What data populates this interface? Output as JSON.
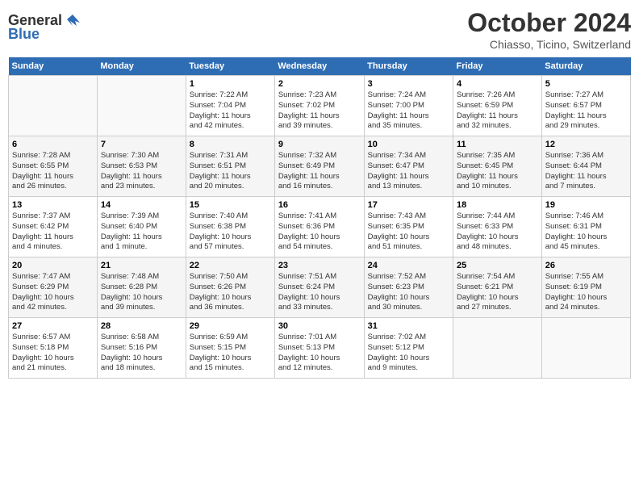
{
  "logo": {
    "general": "General",
    "blue": "Blue"
  },
  "title": "October 2024",
  "subtitle": "Chiasso, Ticino, Switzerland",
  "days_header": [
    "Sunday",
    "Monday",
    "Tuesday",
    "Wednesday",
    "Thursday",
    "Friday",
    "Saturday"
  ],
  "weeks": [
    [
      {
        "day": "",
        "info": ""
      },
      {
        "day": "",
        "info": ""
      },
      {
        "day": "1",
        "info": "Sunrise: 7:22 AM\nSunset: 7:04 PM\nDaylight: 11 hours\nand 42 minutes."
      },
      {
        "day": "2",
        "info": "Sunrise: 7:23 AM\nSunset: 7:02 PM\nDaylight: 11 hours\nand 39 minutes."
      },
      {
        "day": "3",
        "info": "Sunrise: 7:24 AM\nSunset: 7:00 PM\nDaylight: 11 hours\nand 35 minutes."
      },
      {
        "day": "4",
        "info": "Sunrise: 7:26 AM\nSunset: 6:59 PM\nDaylight: 11 hours\nand 32 minutes."
      },
      {
        "day": "5",
        "info": "Sunrise: 7:27 AM\nSunset: 6:57 PM\nDaylight: 11 hours\nand 29 minutes."
      }
    ],
    [
      {
        "day": "6",
        "info": "Sunrise: 7:28 AM\nSunset: 6:55 PM\nDaylight: 11 hours\nand 26 minutes."
      },
      {
        "day": "7",
        "info": "Sunrise: 7:30 AM\nSunset: 6:53 PM\nDaylight: 11 hours\nand 23 minutes."
      },
      {
        "day": "8",
        "info": "Sunrise: 7:31 AM\nSunset: 6:51 PM\nDaylight: 11 hours\nand 20 minutes."
      },
      {
        "day": "9",
        "info": "Sunrise: 7:32 AM\nSunset: 6:49 PM\nDaylight: 11 hours\nand 16 minutes."
      },
      {
        "day": "10",
        "info": "Sunrise: 7:34 AM\nSunset: 6:47 PM\nDaylight: 11 hours\nand 13 minutes."
      },
      {
        "day": "11",
        "info": "Sunrise: 7:35 AM\nSunset: 6:45 PM\nDaylight: 11 hours\nand 10 minutes."
      },
      {
        "day": "12",
        "info": "Sunrise: 7:36 AM\nSunset: 6:44 PM\nDaylight: 11 hours\nand 7 minutes."
      }
    ],
    [
      {
        "day": "13",
        "info": "Sunrise: 7:37 AM\nSunset: 6:42 PM\nDaylight: 11 hours\nand 4 minutes."
      },
      {
        "day": "14",
        "info": "Sunrise: 7:39 AM\nSunset: 6:40 PM\nDaylight: 11 hours\nand 1 minute."
      },
      {
        "day": "15",
        "info": "Sunrise: 7:40 AM\nSunset: 6:38 PM\nDaylight: 10 hours\nand 57 minutes."
      },
      {
        "day": "16",
        "info": "Sunrise: 7:41 AM\nSunset: 6:36 PM\nDaylight: 10 hours\nand 54 minutes."
      },
      {
        "day": "17",
        "info": "Sunrise: 7:43 AM\nSunset: 6:35 PM\nDaylight: 10 hours\nand 51 minutes."
      },
      {
        "day": "18",
        "info": "Sunrise: 7:44 AM\nSunset: 6:33 PM\nDaylight: 10 hours\nand 48 minutes."
      },
      {
        "day": "19",
        "info": "Sunrise: 7:46 AM\nSunset: 6:31 PM\nDaylight: 10 hours\nand 45 minutes."
      }
    ],
    [
      {
        "day": "20",
        "info": "Sunrise: 7:47 AM\nSunset: 6:29 PM\nDaylight: 10 hours\nand 42 minutes."
      },
      {
        "day": "21",
        "info": "Sunrise: 7:48 AM\nSunset: 6:28 PM\nDaylight: 10 hours\nand 39 minutes."
      },
      {
        "day": "22",
        "info": "Sunrise: 7:50 AM\nSunset: 6:26 PM\nDaylight: 10 hours\nand 36 minutes."
      },
      {
        "day": "23",
        "info": "Sunrise: 7:51 AM\nSunset: 6:24 PM\nDaylight: 10 hours\nand 33 minutes."
      },
      {
        "day": "24",
        "info": "Sunrise: 7:52 AM\nSunset: 6:23 PM\nDaylight: 10 hours\nand 30 minutes."
      },
      {
        "day": "25",
        "info": "Sunrise: 7:54 AM\nSunset: 6:21 PM\nDaylight: 10 hours\nand 27 minutes."
      },
      {
        "day": "26",
        "info": "Sunrise: 7:55 AM\nSunset: 6:19 PM\nDaylight: 10 hours\nand 24 minutes."
      }
    ],
    [
      {
        "day": "27",
        "info": "Sunrise: 6:57 AM\nSunset: 5:18 PM\nDaylight: 10 hours\nand 21 minutes."
      },
      {
        "day": "28",
        "info": "Sunrise: 6:58 AM\nSunset: 5:16 PM\nDaylight: 10 hours\nand 18 minutes."
      },
      {
        "day": "29",
        "info": "Sunrise: 6:59 AM\nSunset: 5:15 PM\nDaylight: 10 hours\nand 15 minutes."
      },
      {
        "day": "30",
        "info": "Sunrise: 7:01 AM\nSunset: 5:13 PM\nDaylight: 10 hours\nand 12 minutes."
      },
      {
        "day": "31",
        "info": "Sunrise: 7:02 AM\nSunset: 5:12 PM\nDaylight: 10 hours\nand 9 minutes."
      },
      {
        "day": "",
        "info": ""
      },
      {
        "day": "",
        "info": ""
      }
    ]
  ]
}
